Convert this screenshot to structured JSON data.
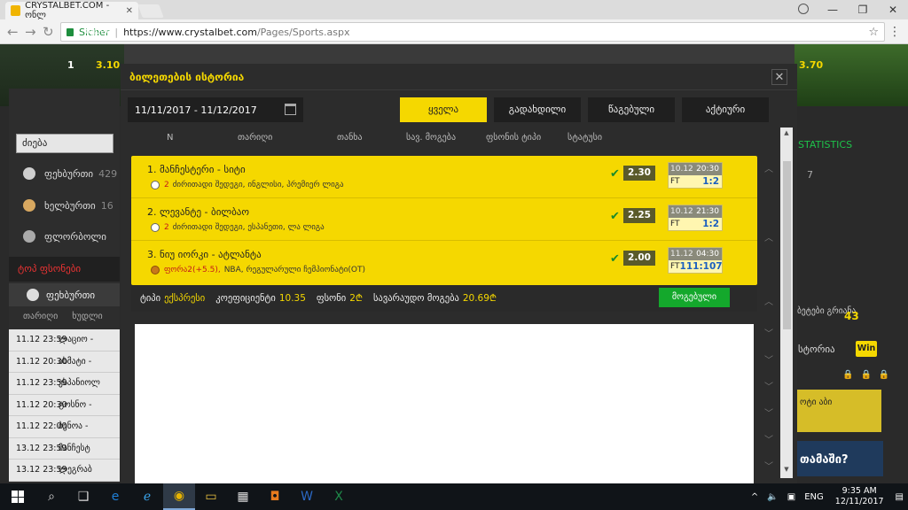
{
  "browser": {
    "tab_title": "CRYSTALBET.COM - ონლ",
    "secure_label": "Sicher",
    "url_host": "https://www.crystalbet.com",
    "url_path": "/Pages/Sports.aspx"
  },
  "background": {
    "team_left": "ბენოა",
    "score_left": "1",
    "odds_left": "3.10",
    "odds_right": "3.70",
    "statistics": "STATISTICS",
    "right_seven": "7",
    "right_43": "43",
    "right_box_text": "ბეტები გრიანა",
    "right_history": "სტორია",
    "win_badge": "Win",
    "yellow_box_text": "ოტი\nაბი",
    "banner_text": "თამაში?",
    "search_placeholder": "ძიება",
    "sports": [
      {
        "name": "ფეხბურთი",
        "count": "429"
      },
      {
        "name": "ხელბურთი",
        "count": "16"
      },
      {
        "name": "ფლორბოლი",
        "count": ""
      }
    ],
    "top_events": "ტოპ ფსონები",
    "football_tab": "ფეხბურთი",
    "events_header": {
      "time": "თარიღი",
      "match": "ხუდლი"
    },
    "events": [
      {
        "time": "11.12 23:59",
        "match": "ლაციო -"
      },
      {
        "time": "11.12 20:30",
        "match": "ახმატი -"
      },
      {
        "time": "11.12 23:59",
        "match": "ესპანიოლ"
      },
      {
        "time": "11.12 20:30",
        "match": "ტოსნო -"
      },
      {
        "time": "11.12 22:00",
        "match": "ბენოა -"
      },
      {
        "time": "13.12 23:59",
        "match": "მანჩესტ"
      },
      {
        "time": "13.12 23:59",
        "match": "ლეგრაბ"
      }
    ]
  },
  "modal": {
    "title": "ბილეთების ისტორია",
    "date_range": "11/11/2017 - 11/12/2017",
    "filters": [
      "ყველა",
      "გადახდილი",
      "წაგებული",
      "აქტიური"
    ],
    "columns": [
      "N",
      "თარიღი",
      "თანხა",
      "სავ. მოგება",
      "ფსონის ტიპი",
      "სტატუსი"
    ],
    "bets": [
      {
        "name": "1. მანჩესტერი - სიტი",
        "market": "2",
        "league": "ძირითადი შედეგი, ინგლისი, პრემიერ ლიგა",
        "sport": "football",
        "odd": "2.30",
        "date": "10.12",
        "time": "20:30",
        "ft": "FT",
        "score": "1:2"
      },
      {
        "name": "2. ლევანტე - ბილბაო",
        "market": "2",
        "league": "ძირითადი შედეგი, ესპანეთი, ლა ლიგა",
        "sport": "football",
        "odd": "2.25",
        "date": "10.12",
        "time": "21:30",
        "ft": "FT",
        "score": "1:2"
      },
      {
        "name": "3. ნიუ იორკი - ატლანტა",
        "market": "ფორა2(+5.5),",
        "league": "NBA, რეგულარული ჩემპიონატი(OT)",
        "sport": "basketball",
        "odd": "2.00",
        "date": "11.12",
        "time": "04:30",
        "ft": "FT",
        "score": "111:107"
      }
    ],
    "summary": {
      "type_label": "ტიპი",
      "type_value": "ექსპრესი",
      "coef_label": "კოეფიციენტი",
      "coef_value": "10.35",
      "stake_label": "ფსონი",
      "stake_value": "2₾",
      "win_label": "სავარაუდო მოგება",
      "win_value": "20.69₾"
    },
    "won_button": "მოგებული"
  },
  "taskbar": {
    "time": "9:35 AM",
    "date": "12/11/2017",
    "lang": "ENG"
  }
}
